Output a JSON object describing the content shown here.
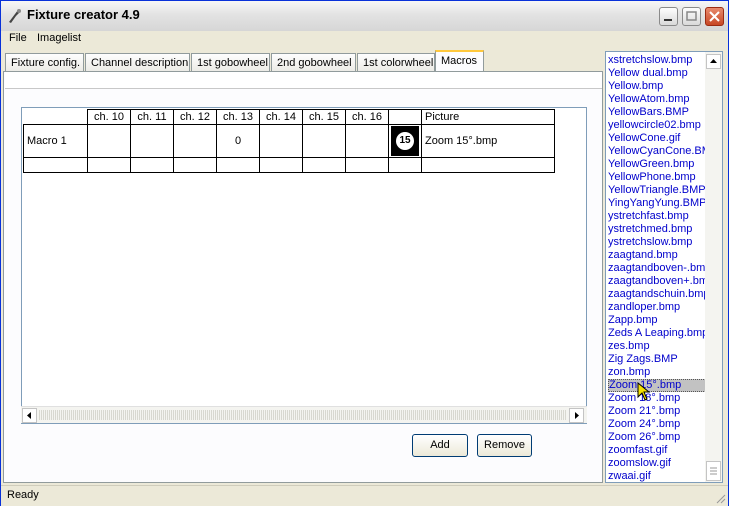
{
  "window": {
    "title": "Fixture creator 4.9"
  },
  "menu": {
    "items": [
      "File",
      "Imagelist"
    ]
  },
  "tabs": [
    "Fixture config.",
    "Channel description",
    "1st gobowheel",
    "2nd gobowheel",
    "1st colorwheel",
    "Macros"
  ],
  "active_tab": "Macros",
  "grid": {
    "columns": [
      "ch. 10",
      "ch. 11",
      "ch. 12",
      "ch. 13",
      "ch. 14",
      "ch. 15",
      "ch. 16",
      "",
      "Picture"
    ],
    "rows": [
      {
        "label": "Macro 1",
        "cells": [
          "",
          "",
          "",
          "0",
          "",
          "",
          ""
        ],
        "icon_text": "15",
        "picture": "Zoom 15°.bmp"
      }
    ]
  },
  "buttons": {
    "add": "Add",
    "remove": "Remove"
  },
  "imagelist": {
    "items": [
      "xstretchslow.bmp",
      "Yellow dual.bmp",
      "Yellow.bmp",
      "YellowAtom.bmp",
      "YellowBars.BMP",
      "yellowcircle02.bmp",
      "YellowCone.gif",
      "YellowCyanCone.BMP",
      "YellowGreen.bmp",
      "YellowPhone.bmp",
      "YellowTriangle.BMP",
      "YingYangYung.BMP",
      "ystretchfast.bmp",
      "ystretchmed.bmp",
      "ystretchslow.bmp",
      "zaagtand.bmp",
      "zaagtandboven-.bmp",
      "zaagtandboven+.bmp",
      "zaagtandschuin.bmp",
      "zandloper.bmp",
      "Zapp.bmp",
      "Zeds A Leaping.bmp",
      "zes.bmp",
      "Zig Zags.BMP",
      "zon.bmp",
      "Zoom 15°.bmp",
      "Zoom 18°.bmp",
      "Zoom 21°.bmp",
      "Zoom 24°.bmp",
      "Zoom 26°.bmp",
      "zoomfast.gif",
      "zoomslow.gif",
      "zwaai.gif"
    ],
    "selected": "Zoom 15°.bmp"
  },
  "status": {
    "text": "Ready"
  }
}
